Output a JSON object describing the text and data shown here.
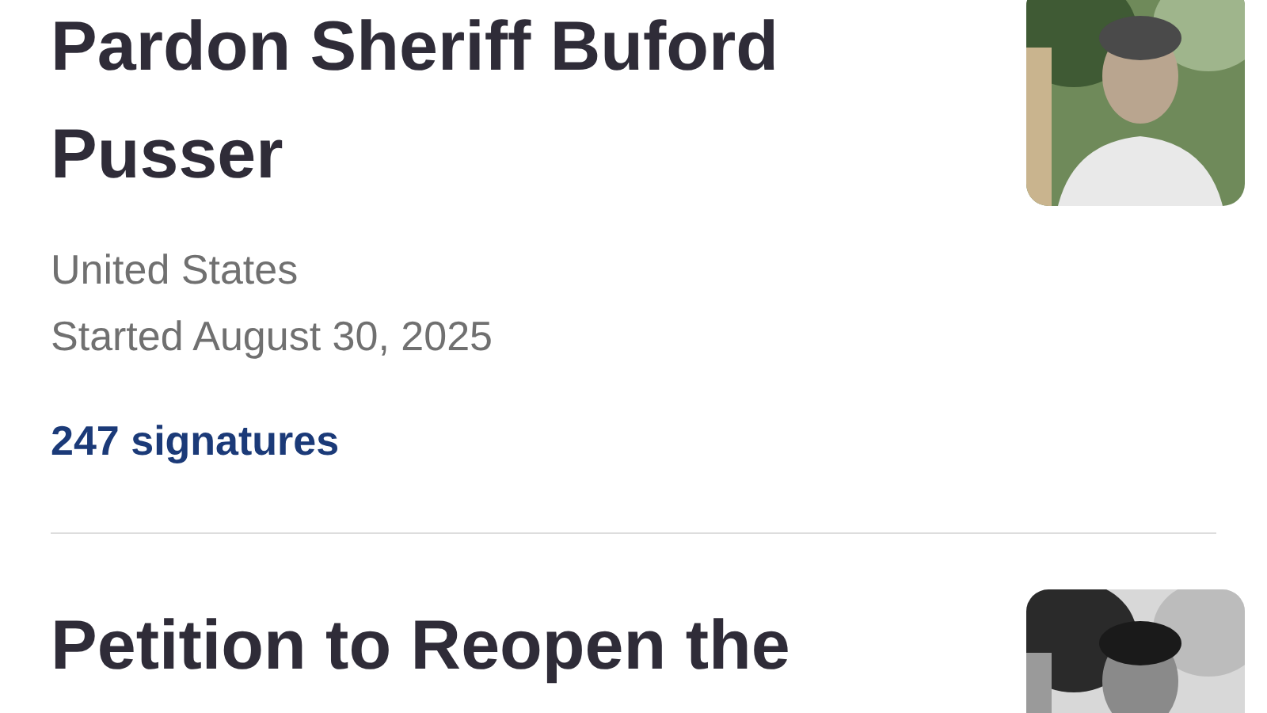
{
  "petitions": [
    {
      "title": "Pardon Sheriff Buford Pusser",
      "location": "United States",
      "started": "Started August 30, 2025",
      "signatures": "247 signatures"
    },
    {
      "title": "Petition to Reopen the"
    }
  ]
}
